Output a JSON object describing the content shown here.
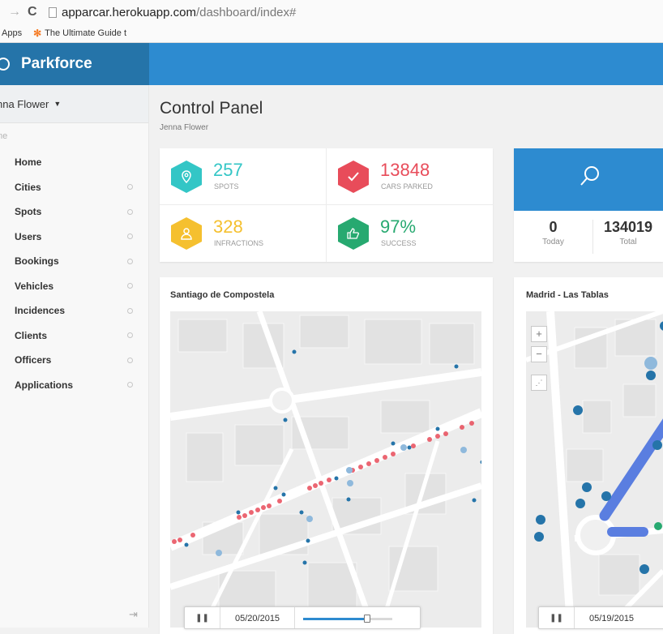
{
  "browser": {
    "url_host": "apparcar.herokuapp.com",
    "url_path": "/dashboard/index#",
    "bookmarks": {
      "apps": "Apps",
      "guide": "The Ultimate Guide t"
    }
  },
  "app": {
    "brand": "Parkforce"
  },
  "sidebar": {
    "user": "nna Flower",
    "crumb": "me",
    "items": [
      {
        "label": "Home",
        "dot": false
      },
      {
        "label": "Cities",
        "dot": true
      },
      {
        "label": "Spots",
        "dot": true
      },
      {
        "label": "Users",
        "dot": true
      },
      {
        "label": "Bookings",
        "dot": true
      },
      {
        "label": "Vehicles",
        "dot": true
      },
      {
        "label": "Incidences",
        "dot": true
      },
      {
        "label": "Clients",
        "dot": true
      },
      {
        "label": "Officers",
        "dot": true
      },
      {
        "label": "Applications",
        "dot": true
      }
    ]
  },
  "header": {
    "title": "Control Panel",
    "subtitle": "Jenna Flower"
  },
  "stats": [
    {
      "value": "257",
      "label": "SPOTS",
      "color": "#33c6c6",
      "icon": "location-pin-icon"
    },
    {
      "value": "13848",
      "label": "CARS PARKED",
      "color": "#e84c5a",
      "icon": "checkmark-icon"
    },
    {
      "value": "328",
      "label": "INFRACTIONS",
      "color": "#f5c02f",
      "icon": "person-icon"
    },
    {
      "value": "97%",
      "label": "SUCCESS",
      "color": "#27a970",
      "icon": "thumbs-up-icon"
    }
  ],
  "search_panel": {
    "today_value": "0",
    "today_label": "Today",
    "total_value": "134019",
    "total_label": "Total"
  },
  "maps": [
    {
      "title": "Santiago de Compostela",
      "date": "05/20/2015",
      "progress": 0.72
    },
    {
      "title": "Madrid - Las Tablas",
      "date": "05/19/2015"
    }
  ],
  "zoom": {
    "in": "+",
    "out": "−"
  }
}
